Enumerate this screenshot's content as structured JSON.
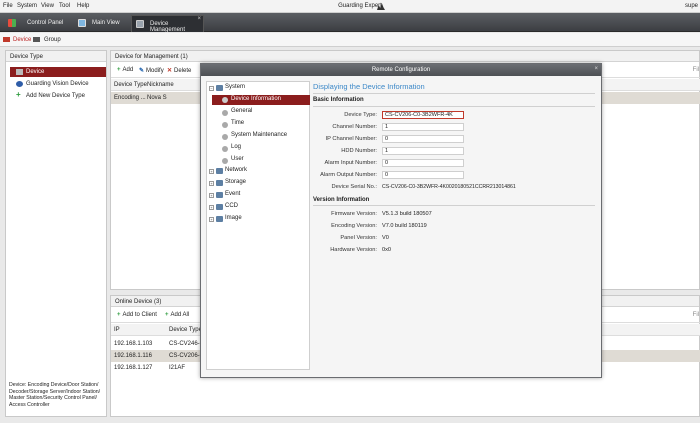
{
  "menubar": {
    "items": [
      "File",
      "System",
      "View",
      "Tool",
      "Help"
    ],
    "title": "Guarding Expert",
    "user": "supe"
  },
  "tabs": {
    "control_panel": "Control Panel",
    "main_view": "Main View",
    "device_management": "Device Management",
    "close": "×"
  },
  "subtabs": {
    "device": "Device",
    "group": "Group"
  },
  "left": {
    "header": "Device Type",
    "items": [
      "Device",
      "Guarding Vision Device",
      "Add New Device Type"
    ],
    "description": "Device: Encoding Device/Door Station/ Decoder/Storage Server/Indoor Station/ Master Station/Security Control Panel/ Access Controller"
  },
  "main": {
    "header": "Device for Management (1)",
    "toolbar": {
      "add": "Add",
      "modify": "Modify",
      "delete": "Delete"
    },
    "columns": {
      "type": "Device Type",
      "nickname": "Nickname"
    },
    "row": {
      "type": "Encoding ...",
      "nickname": "Nova S"
    },
    "filter": "Fil"
  },
  "online": {
    "header": "Online Device (3)",
    "toolbar": {
      "add_to_client": "Add to Client",
      "add_all": "Add All"
    },
    "columns": {
      "ip": "IP",
      "type": "Device Type"
    },
    "rows": [
      {
        "ip": "192.168.1.103",
        "type": "CS-CV246-C0-3B2"
      },
      {
        "ip": "192.168.1.116",
        "type": "CS-CV206-C0-3B2"
      },
      {
        "ip": "192.168.1.127",
        "type": "I21AF"
      }
    ],
    "filter": "Fil"
  },
  "dialog": {
    "title": "Remote Configuration",
    "close": "×",
    "tree": {
      "system": "System",
      "device_information": "Device Information",
      "general": "General",
      "time": "Time",
      "system_maintenance": "System Maintenance",
      "log": "Log",
      "user": "User",
      "network": "Network",
      "storage": "Storage",
      "event": "Event",
      "ccd": "CCD",
      "image": "Image"
    },
    "heading": "Displaying the Device Information",
    "basic_header": "Basic Information",
    "fields": {
      "device_type_label": "Device Type:",
      "device_type_value": "CS-CV206-C0-3B2WFR-4K",
      "channel_number_label": "Channel Number:",
      "channel_number_value": "1",
      "ip_channel_number_label": "IP Channel Number:",
      "ip_channel_number_value": "0",
      "hdd_number_label": "HDD Number:",
      "hdd_number_value": "1",
      "alarm_input_label": "Alarm Input Number:",
      "alarm_input_value": "0",
      "alarm_output_label": "Alarm Output Number:",
      "alarm_output_value": "0",
      "serial_label": "Device Serial No.:",
      "serial_value": "CS-CV206-C0-3B2WFR-4K0020180521CCRR213014861"
    },
    "version_header": "Version Information",
    "versions": {
      "firmware_label": "Firmware Version:",
      "firmware_value": "V5.1.3 build 180507",
      "encoding_label": "Encoding Version:",
      "encoding_value": "V7.0 build 180119",
      "panel_label": "Panel Version:",
      "panel_value": "V0",
      "hardware_label": "Hardware Version:",
      "hardware_value": "0x0"
    }
  },
  "colors": {
    "selection": "#8b1d1d",
    "heading": "#3c88c8",
    "add_green": "#2e9c3e",
    "delete_red": "#c0392b"
  }
}
